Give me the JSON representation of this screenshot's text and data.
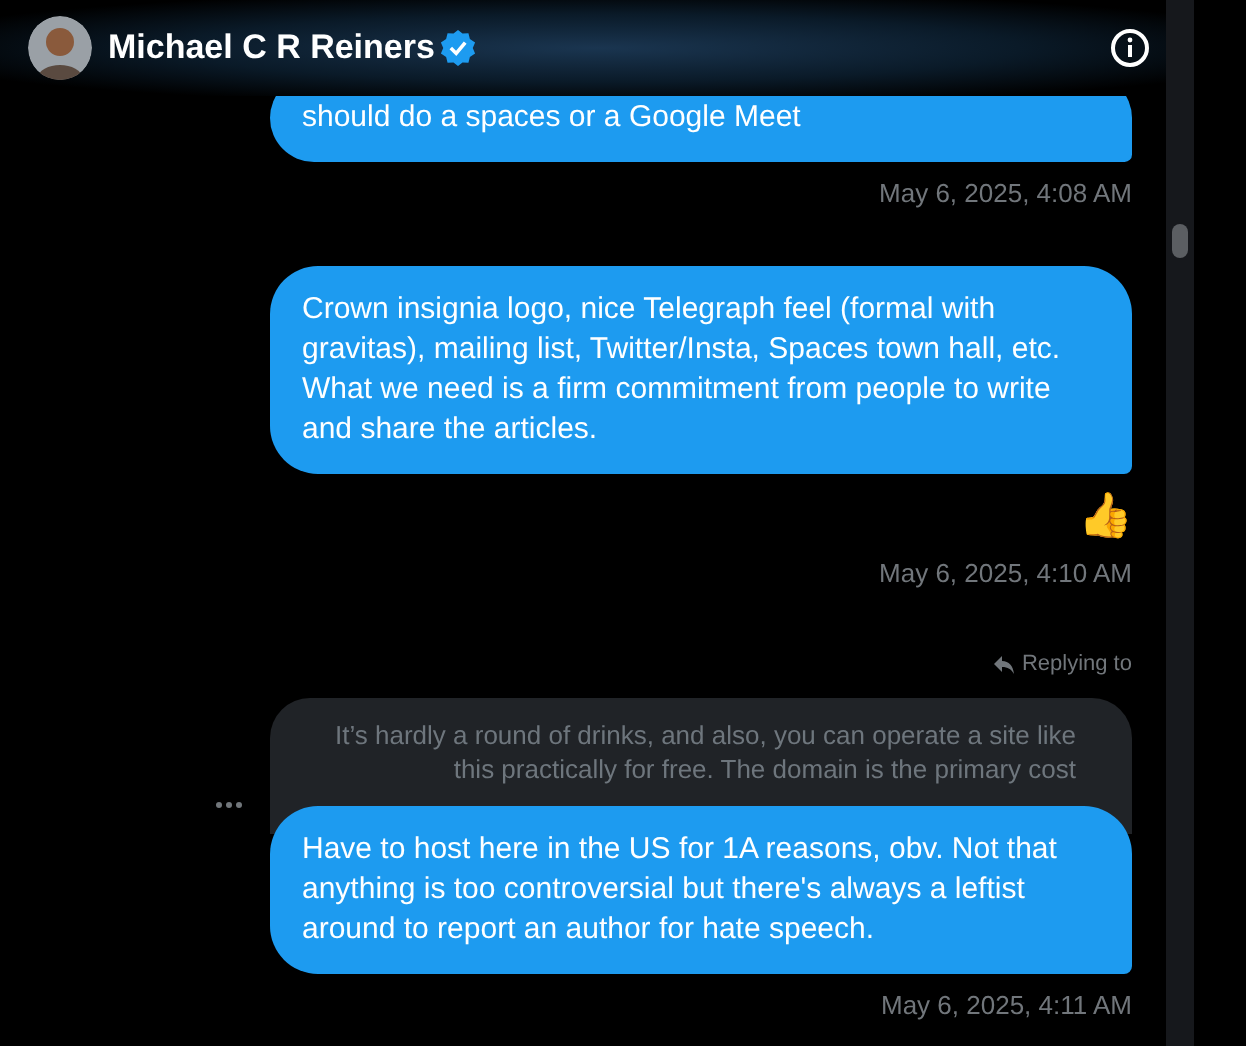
{
  "header": {
    "name": "Michael C R Reiners",
    "verified": true
  },
  "messages": [
    {
      "kind": "message",
      "text": "should do a spaces or a Google Meet",
      "time": "May 6, 2025, 4:08 AM"
    },
    {
      "kind": "message",
      "text": "Crown insignia logo, nice Telegraph feel (formal with gravitas), mailing list, Twitter/Insta, Spaces town hall, etc. What we need is a firm commitment from people to write and share the articles.",
      "reaction": "👍",
      "time": "May 6, 2025, 4:10 AM"
    },
    {
      "kind": "reply",
      "replying_label": "Replying to",
      "quoted": "It’s hardly a round of drinks, and also, you can operate a site like this practically for free. The domain is the primary cost",
      "text": "Have to host here in the US for 1A reasons, obv. Not that anything is too controversial but there's always a leftist around to report an author for hate speech.",
      "time": "May 6, 2025, 4:11 AM"
    }
  ]
}
